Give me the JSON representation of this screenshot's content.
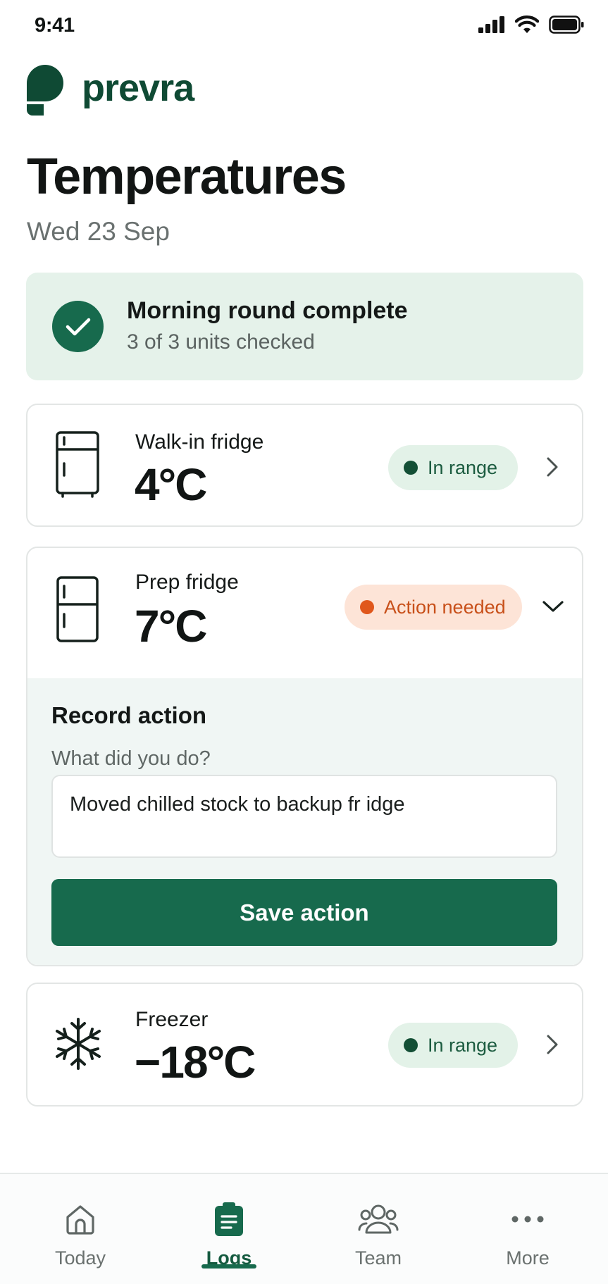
{
  "status_bar": {
    "time": "9:41"
  },
  "brand": {
    "name": "prevra",
    "color": "#0f4a34"
  },
  "page": {
    "title": "Temperatures",
    "date": "Wed 23 Sep"
  },
  "summary": {
    "title": "Morning round complete",
    "subtitle": "3 of 3 units checked"
  },
  "units": [
    {
      "name": "Walk-in fridge",
      "temp": "4°C",
      "status": "In range",
      "icon": "fridge-icon",
      "state": "ok"
    },
    {
      "name": "Prep fridge",
      "temp": "7°C",
      "status": "Action needed",
      "icon": "fridge-icon",
      "state": "warning",
      "expanded": true
    },
    {
      "name": "Freezer",
      "temp": "−18°C",
      "status": "In range",
      "icon": "snowflake-icon",
      "state": "ok"
    }
  ],
  "action": {
    "title": "Record action",
    "label": "What did you do?",
    "value": "Moved chilled stock to backup fr idge",
    "save_label": "Save action"
  },
  "nav": [
    {
      "label": "Today",
      "icon": "home-icon"
    },
    {
      "label": "Logs",
      "icon": "clipboard-icon",
      "active": true
    },
    {
      "label": "Team",
      "icon": "people-icon"
    },
    {
      "label": "More",
      "icon": "more-dots-icon"
    }
  ],
  "colors": {
    "accent": "#176a4d",
    "ok_badge_bg": "#e3f2e8",
    "warn_badge_bg": "#fde4d7",
    "warn_text": "#c8501a"
  }
}
